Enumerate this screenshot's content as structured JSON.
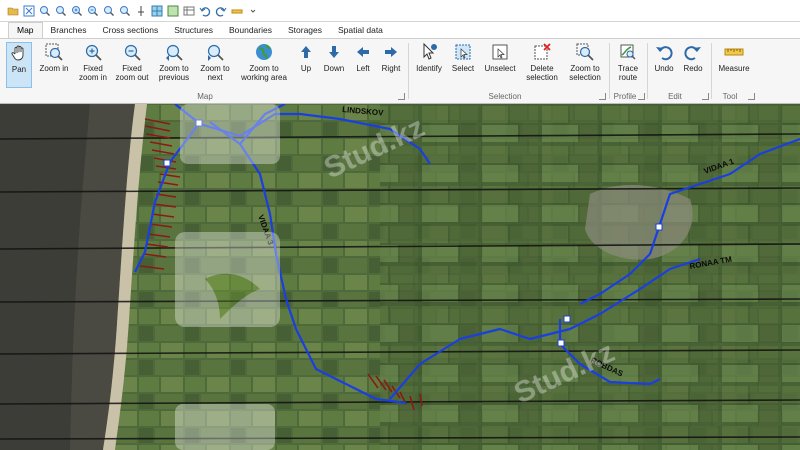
{
  "quick_access": {
    "icons": [
      "open-folder-icon",
      "zoom-extent-icon",
      "zoom-in-icon",
      "zoom-out-icon",
      "zoom-fixed-in-icon",
      "zoom-fixed-out-icon",
      "zoom-prev-icon",
      "zoom-next-icon",
      "grid-icon",
      "layer-icon",
      "table-icon",
      "undo-icon",
      "redo-icon",
      "measure-icon",
      "pin-icon",
      "dropdown-icon"
    ]
  },
  "tabs": [
    "Map",
    "Branches",
    "Cross sections",
    "Structures",
    "Boundaries",
    "Storages",
    "Spatial data"
  ],
  "active_tab": "Map",
  "ribbon": {
    "buttons": {
      "pan": "Pan",
      "zoom_in": "Zoom in",
      "fixed_zoom_in": "Fixed\nzoom in",
      "fixed_zoom_out": "Fixed\nzoom out",
      "zoom_prev": "Zoom to\nprevious",
      "zoom_next": "Zoom to\nnext",
      "zoom_working": "Zoom to\nworking area",
      "up": "Up",
      "down": "Down",
      "left": "Left",
      "right": "Right",
      "identify": "Identify",
      "select": "Select",
      "unselect": "Unselect",
      "delete_sel": "Delete\nselection",
      "zoom_sel": "Zoom to\nselection",
      "trace": "Trace\nroute",
      "undo": "Undo",
      "redo": "Redo",
      "measure": "Measure"
    },
    "groups": {
      "map": "Map",
      "selection": "Selection",
      "profile": "Profile",
      "edit": "Edit",
      "tool": "Tool"
    }
  },
  "map": {
    "labels": [
      "LINDSKOV",
      "VIDAA 3",
      "VIDAA 1",
      "RONAA TM",
      "ROBDAS"
    ],
    "watermark": "Stud.kz"
  },
  "colors": {
    "accent": "#cbe4f6",
    "branch": "#1a3fe0",
    "node": "#ffffff"
  }
}
